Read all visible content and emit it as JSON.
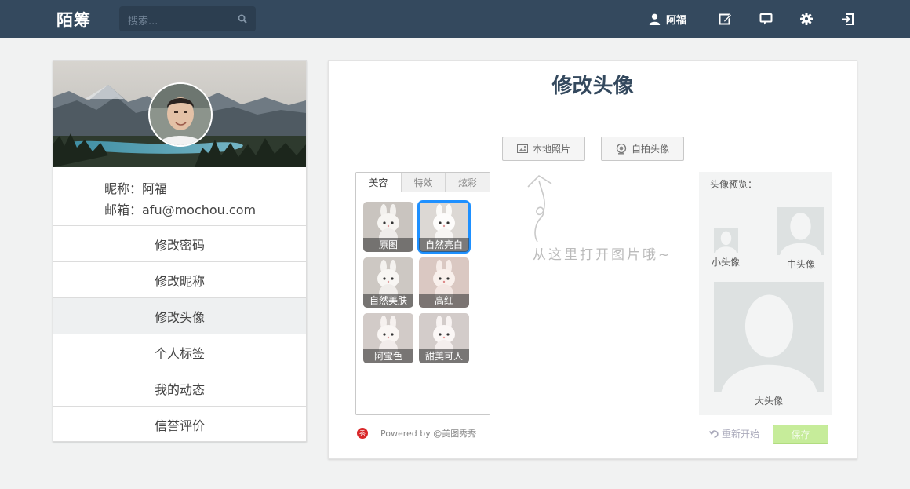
{
  "navbar": {
    "brand": "陌筹",
    "search_placeholder": "搜索...",
    "username": "阿福",
    "icons": [
      "user-icon",
      "edit-icon",
      "message-icon",
      "gear-icon",
      "logout-icon"
    ]
  },
  "profile": {
    "nickname_line": "昵称：阿福",
    "email_line": "邮箱：afu@mochou.com",
    "menu": [
      {
        "label": "修改密码",
        "active": false
      },
      {
        "label": "修改昵称",
        "active": false
      },
      {
        "label": "修改头像",
        "active": true
      },
      {
        "label": "个人标签",
        "active": false
      },
      {
        "label": "我的动态",
        "active": false
      },
      {
        "label": "信誉评价",
        "active": false
      }
    ]
  },
  "editor": {
    "title": "修改头像",
    "local_photo_label": "本地照片",
    "selfie_label": "自拍头像",
    "tabs": [
      "美容",
      "特效",
      "炫彩"
    ],
    "active_tab": "美容",
    "filters": [
      "原图",
      "自然亮白",
      "自然美肤",
      "高红",
      "阿宝色",
      "甜美可人"
    ],
    "selected_filter": "自然亮白",
    "hint_text": "从这里打开图片哦~",
    "preview_title": "头像预览：",
    "small_label": "小头像",
    "medium_label": "中头像",
    "large_label": "大头像",
    "powered_logo": "秀",
    "powered_text": "Powered by @美图秀秀",
    "restart_label": "重新开始",
    "save_label": "保存"
  },
  "colors": {
    "navbar": "#34495e",
    "selected_outline": "#1e90ff",
    "save_button": "#c6ec9a"
  }
}
